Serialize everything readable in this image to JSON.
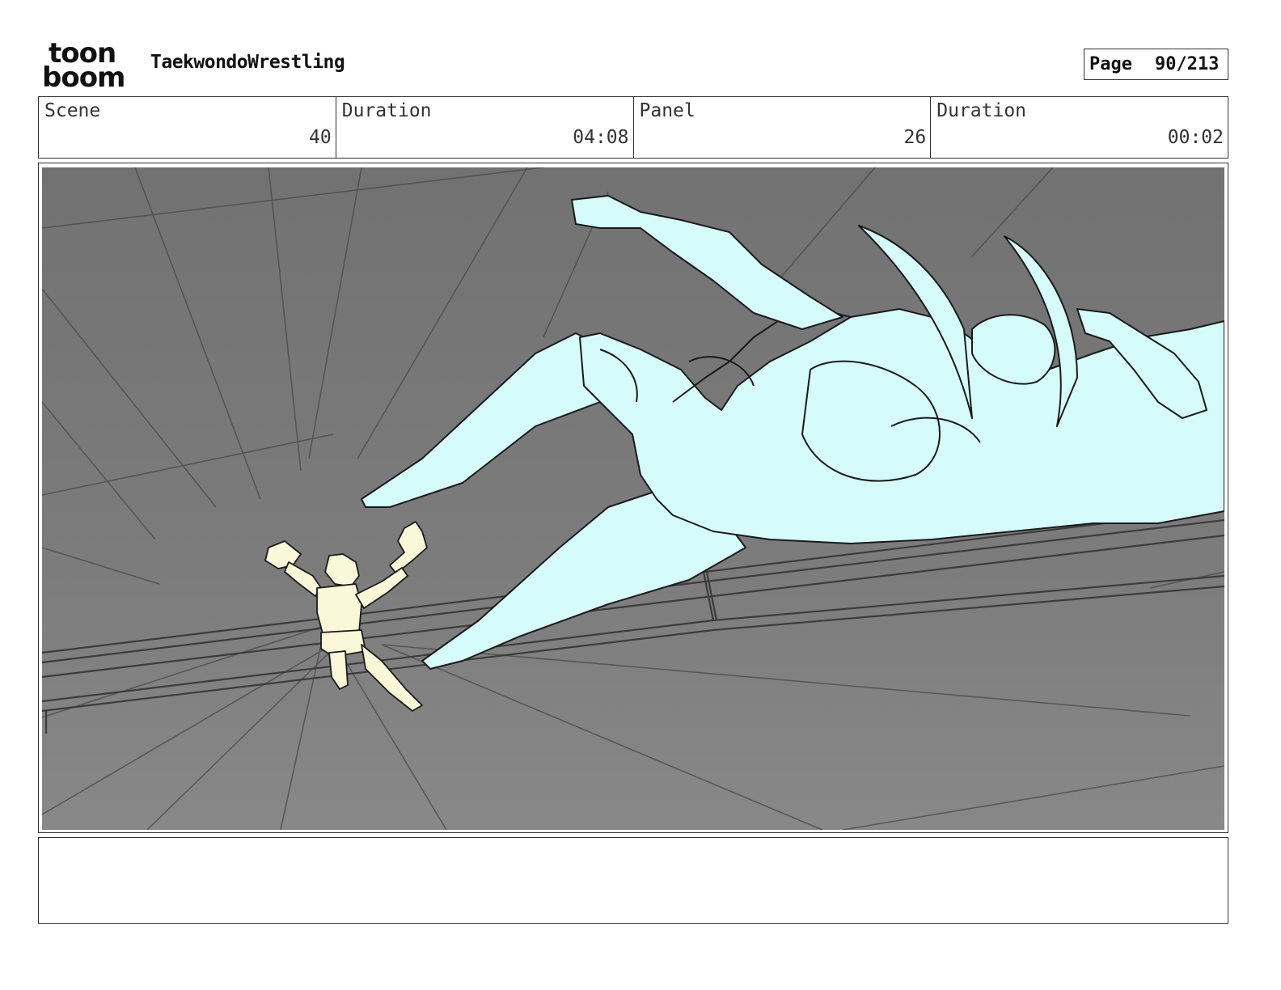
{
  "header": {
    "logo": {
      "line1": "toon",
      "line2": "boom"
    },
    "project_title": "TaekwondoWrestling",
    "page": {
      "label": "Page",
      "value": "90/213"
    }
  },
  "info": {
    "scene_label": "Scene",
    "scene_value": "40",
    "scene_duration_label": "Duration",
    "scene_duration_value": "04:08",
    "panel_label": "Panel",
    "panel_value": "26",
    "panel_duration_label": "Duration",
    "panel_duration_value": "00:02"
  },
  "colors": {
    "floor": "#7d7d7d",
    "giant_fill": "#d6fbfb",
    "hero_fill": "#fbf7d9",
    "ink": "#1a1a1a"
  }
}
